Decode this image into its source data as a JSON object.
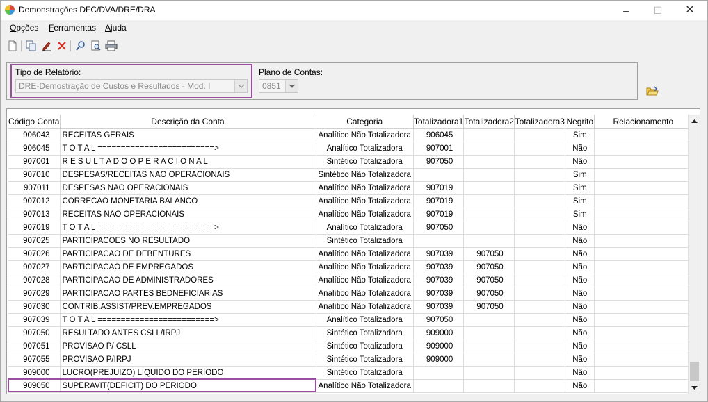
{
  "window": {
    "title": "Demonstrações DFC/DVA/DRE/DRA"
  },
  "menu": [
    {
      "underline": "O",
      "rest": "pções"
    },
    {
      "underline": "F",
      "rest": "erramentas"
    },
    {
      "underline": "A",
      "rest": "juda"
    }
  ],
  "report": {
    "type_label": "Tipo de Relatório:",
    "type_value": "DRE-Demostração de Custos e Resultados - Mod. I",
    "plan_label": "Plano de Contas:",
    "plan_value": "0851"
  },
  "grid": {
    "columns": [
      "Código Conta",
      "Descrição da Conta",
      "Categoria",
      "Totalizadora1",
      "Totalizadora2",
      "Totalizadora3",
      "Negrito",
      "Relacionamento"
    ],
    "rows": [
      {
        "code": "906043",
        "desc": "RECEITAS GERAIS",
        "cat": "Analítico Não Totalizadora",
        "t1": "906045",
        "t2": "",
        "t3": "",
        "neg": "Sim",
        "rel": ""
      },
      {
        "code": "906045",
        "desc": "T O T A L =========================>",
        "cat": "Analítico Totalizadora",
        "t1": "907001",
        "t2": "",
        "t3": "",
        "neg": "Não",
        "rel": ""
      },
      {
        "code": "907001",
        "desc": "R E S U L T A D O   O P E R A C I O N A L",
        "cat": "Sintético Totalizadora",
        "t1": "907050",
        "t2": "",
        "t3": "",
        "neg": "Não",
        "rel": ""
      },
      {
        "code": "907010",
        "desc": "DESPESAS/RECEITAS NAO OPERACIONAIS",
        "cat": "Sintético Não Totalizadora",
        "t1": "",
        "t2": "",
        "t3": "",
        "neg": "Sim",
        "rel": ""
      },
      {
        "code": "907011",
        "desc": "DESPESAS NAO OPERACIONAIS",
        "cat": "Analítico Não Totalizadora",
        "t1": "907019",
        "t2": "",
        "t3": "",
        "neg": "Sim",
        "rel": ""
      },
      {
        "code": "907012",
        "desc": "CORRECAO MONETARIA BALANCO",
        "cat": "Analítico Não Totalizadora",
        "t1": "907019",
        "t2": "",
        "t3": "",
        "neg": "Sim",
        "rel": ""
      },
      {
        "code": "907013",
        "desc": "RECEITAS NAO OPERACIONAIS",
        "cat": "Analítico Não Totalizadora",
        "t1": "907019",
        "t2": "",
        "t3": "",
        "neg": "Sim",
        "rel": ""
      },
      {
        "code": "907019",
        "desc": "T O T A L =========================>",
        "cat": "Analítico Totalizadora",
        "t1": "907050",
        "t2": "",
        "t3": "",
        "neg": "Não",
        "rel": ""
      },
      {
        "code": "907025",
        "desc": "PARTICIPACOES NO RESULTADO",
        "cat": "Sintético Totalizadora",
        "t1": "",
        "t2": "",
        "t3": "",
        "neg": "Não",
        "rel": ""
      },
      {
        "code": "907026",
        "desc": "PARTICIPACAO DE DEBENTURES",
        "cat": "Analítico Não Totalizadora",
        "t1": "907039",
        "t2": "907050",
        "t3": "",
        "neg": "Não",
        "rel": ""
      },
      {
        "code": "907027",
        "desc": "PARTICIPACAO DE EMPREGADOS",
        "cat": "Analítico Não Totalizadora",
        "t1": "907039",
        "t2": "907050",
        "t3": "",
        "neg": "Não",
        "rel": ""
      },
      {
        "code": "907028",
        "desc": "PARTICIPACAO DE ADMINISTRADORES",
        "cat": "Analítico Não Totalizadora",
        "t1": "907039",
        "t2": "907050",
        "t3": "",
        "neg": "Não",
        "rel": ""
      },
      {
        "code": "907029",
        "desc": "PARTICIPACAO PARTES BEDNEFICIARIAS",
        "cat": "Analítico Não Totalizadora",
        "t1": "907039",
        "t2": "907050",
        "t3": "",
        "neg": "Não",
        "rel": ""
      },
      {
        "code": "907030",
        "desc": "CONTRIB.ASSIST/PREV.EMPREGADOS",
        "cat": "Analítico Não Totalizadora",
        "t1": "907039",
        "t2": "907050",
        "t3": "",
        "neg": "Não",
        "rel": ""
      },
      {
        "code": "907039",
        "desc": "T O T A L =========================>",
        "cat": "Analítico Totalizadora",
        "t1": "907050",
        "t2": "",
        "t3": "",
        "neg": "Não",
        "rel": ""
      },
      {
        "code": "907050",
        "desc": "RESULTADO ANTES CSLL/IRPJ",
        "cat": "Sintético Totalizadora",
        "t1": "909000",
        "t2": "",
        "t3": "",
        "neg": "Não",
        "rel": ""
      },
      {
        "code": "907051",
        "desc": "PROVISAO P/ CSLL",
        "cat": "Sintético Totalizadora",
        "t1": "909000",
        "t2": "",
        "t3": "",
        "neg": "Não",
        "rel": ""
      },
      {
        "code": "907055",
        "desc": "PROVISAO P/IRPJ",
        "cat": "Sintético Totalizadora",
        "t1": "909000",
        "t2": "",
        "t3": "",
        "neg": "Não",
        "rel": ""
      },
      {
        "code": "909000",
        "desc": "LUCRO(PREJUIZO) LIQUIDO DO PERIODO",
        "cat": "Sintético Totalizadora",
        "t1": "",
        "t2": "",
        "t3": "",
        "neg": "Não",
        "rel": ""
      },
      {
        "code": "909050",
        "desc": "SUPERAVIT(DEFICIT) DO PERIODO",
        "cat": "Analítico Não Totalizadora",
        "t1": "",
        "t2": "",
        "t3": "",
        "neg": "Não",
        "rel": ""
      }
    ]
  },
  "icons": {
    "toolbar": [
      "new-document-icon",
      "copy-icon",
      "edit-icon",
      "delete-icon",
      "search-icon",
      "preview-icon",
      "print-icon"
    ],
    "side": "open-folder-icon"
  },
  "colors": {
    "highlight": "#9b4ea0",
    "delete": "#d42a1c"
  }
}
